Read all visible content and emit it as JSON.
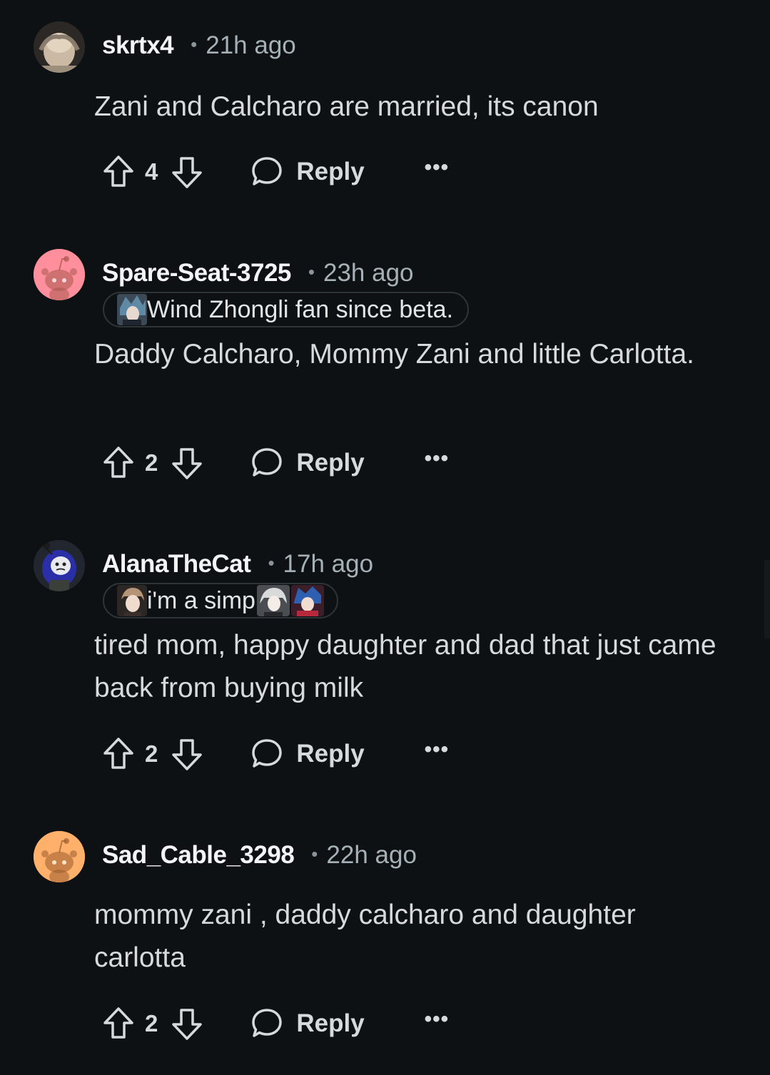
{
  "comments": [
    {
      "username": "skrtx4",
      "time": "21h ago",
      "flair": null,
      "body": "Zani and Calcharo are married, its canon",
      "score": "4",
      "reply_label": "Reply",
      "more_label": "•••",
      "avatar_color": "#c9b8a2"
    },
    {
      "username": "Spare-Seat-3725",
      "time": "23h ago",
      "flair": "Wind Zhongli fan since beta.",
      "body": "Daddy Calcharo, Mommy Zani and little Carlotta.",
      "score": "2",
      "reply_label": "Reply",
      "more_label": "•••",
      "avatar_color": "#ff8f9c"
    },
    {
      "username": "AlanaTheCat",
      "time": "17h ago",
      "flair": "i'm a simp",
      "body": "tired mom, happy daughter and dad that just came back from buying milk",
      "score": "2",
      "reply_label": "Reply",
      "more_label": "•••",
      "avatar_color": "#1a1f3a"
    },
    {
      "username": "Sad_Cable_3298",
      "time": "22h ago",
      "flair": null,
      "body": "mommy zani , daddy calcharo and daughter carlotta",
      "score": "2",
      "reply_label": "Reply",
      "more_label": "•••",
      "avatar_color": "#ffb06b"
    }
  ],
  "icons": {
    "upvote": "arrow-up-outline-icon",
    "downvote": "arrow-down-outline-icon",
    "reply": "speech-bubble-icon",
    "more": "ellipsis-icon"
  },
  "colors": {
    "background": "#0e1113",
    "text": "#d7dadc",
    "muted": "#a5b1b7"
  }
}
